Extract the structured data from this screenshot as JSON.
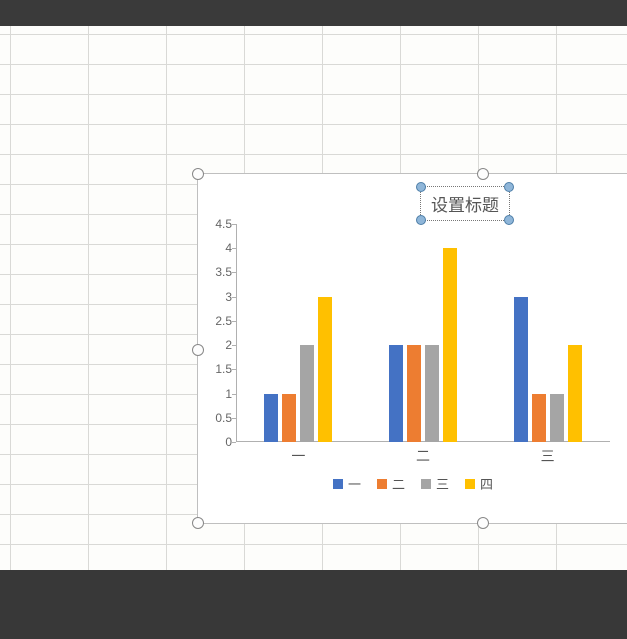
{
  "chart_data": {
    "type": "bar",
    "title": "设置标题",
    "categories": [
      "一",
      "二",
      "三"
    ],
    "series": [
      {
        "name": "一",
        "color": "#4472c4",
        "values": [
          1,
          2,
          3
        ]
      },
      {
        "name": "二",
        "color": "#ed7d31",
        "values": [
          1,
          2,
          1
        ]
      },
      {
        "name": "三",
        "color": "#a5a5a5",
        "values": [
          2,
          2,
          1
        ]
      },
      {
        "name": "四",
        "color": "#ffc000",
        "values": [
          3,
          4,
          2
        ]
      }
    ],
    "ylim": [
      0,
      4.5
    ],
    "yticks": [
      0,
      0.5,
      1,
      1.5,
      2,
      2.5,
      3,
      3.5,
      4,
      4.5
    ],
    "xlabel": "",
    "ylabel": ""
  }
}
